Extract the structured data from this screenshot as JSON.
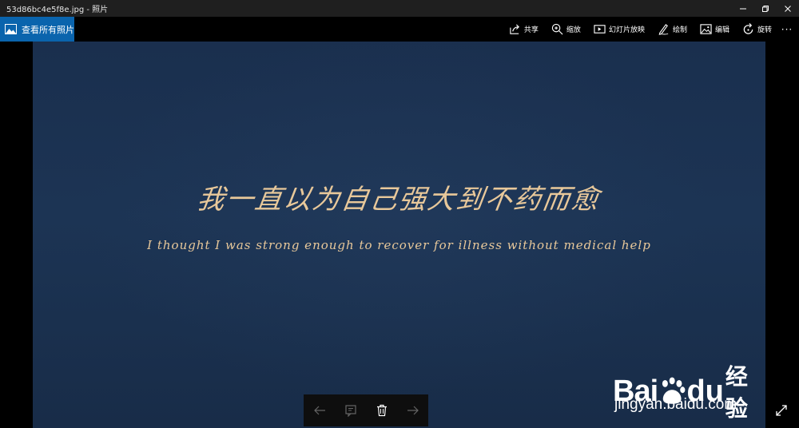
{
  "window": {
    "title": "53d86bc4e5f8e.jpg - 照片",
    "controls": [
      "minimize-icon",
      "restore-icon",
      "close-icon"
    ]
  },
  "toolbar": {
    "all_photos_label": "查看所有照片",
    "actions": [
      {
        "label": "共享",
        "icon": "share-icon"
      },
      {
        "label": "缩放",
        "icon": "zoom-icon"
      },
      {
        "label": "幻灯片放映",
        "icon": "slideshow-icon"
      },
      {
        "label": "绘制",
        "icon": "draw-icon"
      },
      {
        "label": "编辑",
        "icon": "edit-icon"
      },
      {
        "label": "旋转",
        "icon": "rotate-icon"
      }
    ],
    "more_label": "···"
  },
  "photo": {
    "cn_text": "我一直以为自己强大到不药而愈",
    "en_text": "I thought I was strong enough to recover for illness without medical help",
    "watermark_logo_bai": "Bai",
    "watermark_logo_du": "du",
    "watermark_logo_jingyan": "经验",
    "watermark_url": "jingyan.baidu.com",
    "background_color": "#1c3454",
    "text_color": "#e8c89a"
  },
  "navigation": {
    "buttons": [
      "previous-icon",
      "info-icon",
      "delete-icon",
      "next-icon"
    ]
  },
  "colors": {
    "accent": "#0a64ad",
    "titlebar": "#1f1f1f"
  }
}
